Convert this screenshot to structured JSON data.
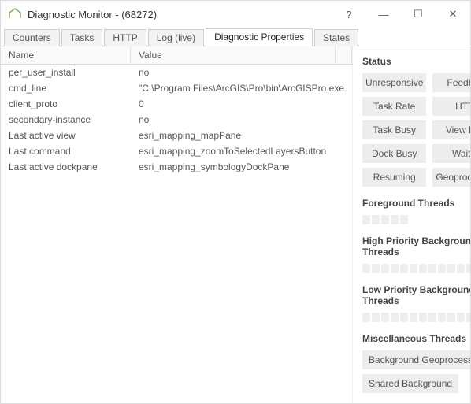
{
  "window": {
    "title": "Diagnostic Monitor - (68272)",
    "help": "?",
    "minimize": "—",
    "maximize": "☐",
    "close": "✕"
  },
  "tabs": [
    "Counters",
    "Tasks",
    "HTTP",
    "Log (live)",
    "Diagnostic Properties",
    "States"
  ],
  "active_tab_index": 4,
  "grid": {
    "headers": {
      "name": "Name",
      "value": "Value"
    },
    "rows": [
      {
        "name": "per_user_install",
        "value": "no"
      },
      {
        "name": "cmd_line",
        "value": "\"C:\\Program Files\\ArcGIS\\Pro\\bin\\ArcGISPro.exe"
      },
      {
        "name": "client_proto",
        "value": "0"
      },
      {
        "name": "secondary-instance",
        "value": "no"
      },
      {
        "name": "Last active view",
        "value": "esri_mapping_mapPane"
      },
      {
        "name": "Last command",
        "value": "esri_mapping_zoomToSelectedLayersButton"
      },
      {
        "name": "Last active dockpane",
        "value": "esri_mapping_symbologyDockPane"
      }
    ]
  },
  "status": {
    "title": "Status",
    "items": [
      "Unresponsive",
      "Feedback",
      "Task Rate",
      "HTTP",
      "Task Busy",
      "View Busy",
      "Dock Busy",
      "Waiting",
      "Resuming",
      "Geoprocessing"
    ]
  },
  "thread_sections": [
    {
      "title": "Foreground Threads",
      "segments": 5
    },
    {
      "title": "High Priority Background Threads",
      "segments": 14
    },
    {
      "title": "Low Priority Background Threads",
      "segments": 14
    }
  ],
  "misc": {
    "title": "Miscellaneous Threads",
    "items": [
      "Background Geoprocessing",
      "Shared Background"
    ]
  }
}
